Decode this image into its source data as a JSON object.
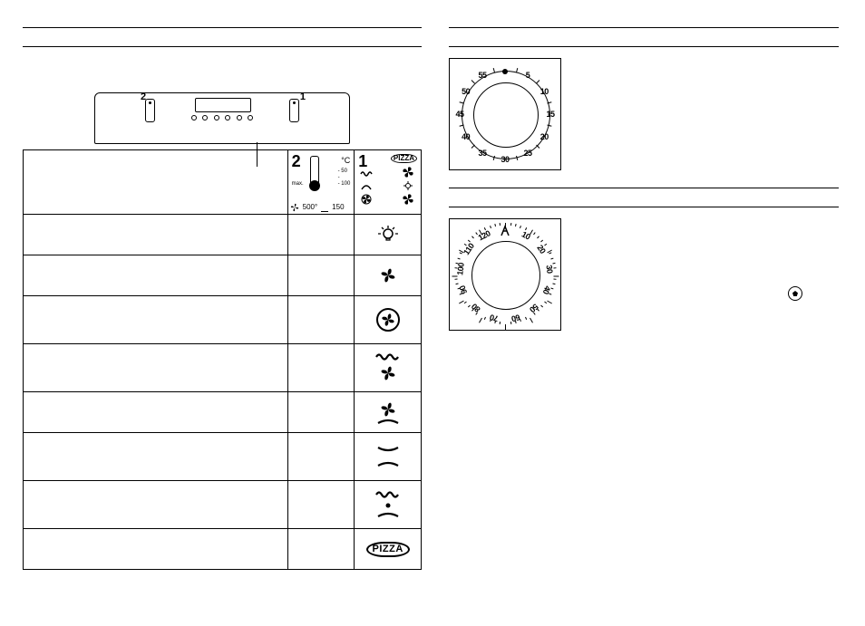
{
  "panel": {
    "knob_left_num": "2",
    "knob_right_num": "1"
  },
  "table_header": {
    "col2_big": "2",
    "col2_unit": "°C",
    "col2_max": "max.",
    "col2_ticks": "- 50\n-\n- 100",
    "col2_bottom_left": "500°",
    "col2_bottom_right": "150",
    "col1_big": "1",
    "col1_pizza": "PIZZA"
  },
  "rows": {
    "pizza_label": "PIZZA"
  },
  "dial_minute": {
    "numbers": [
      "5",
      "10",
      "15",
      "20",
      "25",
      "30",
      "35",
      "40",
      "45",
      "50",
      "55"
    ]
  },
  "dial_timer": {
    "numbers": [
      "10",
      "20",
      "30",
      "40",
      "50",
      "60",
      "70",
      "80",
      "90",
      "100",
      "110",
      "120"
    ]
  }
}
